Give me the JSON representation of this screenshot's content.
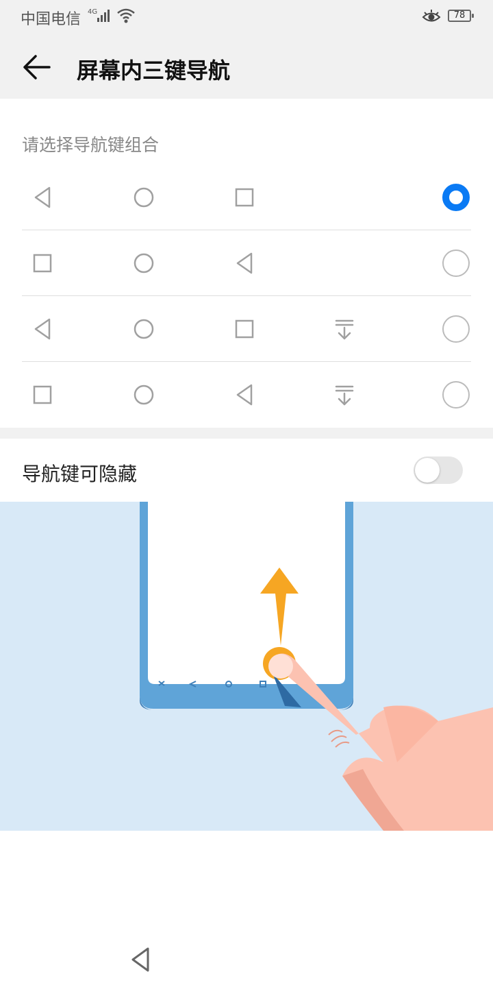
{
  "status_bar": {
    "carrier": "中国电信",
    "network": "4G",
    "battery": "78"
  },
  "header": {
    "title": "屏幕内三键导航"
  },
  "section": {
    "label": "请选择导航键组合"
  },
  "options": [
    {
      "keys": [
        "back-triangle-icon",
        "home-circle-icon",
        "recent-square-icon"
      ],
      "selected": true
    },
    {
      "keys": [
        "recent-square-icon",
        "home-circle-icon",
        "back-triangle-icon"
      ],
      "selected": false
    },
    {
      "keys": [
        "back-triangle-icon",
        "home-circle-icon",
        "recent-square-icon",
        "notification-down-icon"
      ],
      "selected": false
    },
    {
      "keys": [
        "recent-square-icon",
        "home-circle-icon",
        "back-triangle-icon",
        "notification-down-icon"
      ],
      "selected": false
    }
  ],
  "hide_toggle": {
    "label": "导航键可隐藏",
    "on": false
  },
  "colors": {
    "accent": "#0a7af4",
    "illustration_bg": "#d8e9f7",
    "phone_frame": "#5fa4d8",
    "arrow": "#f6a623",
    "finger": "#fcc2b1"
  }
}
